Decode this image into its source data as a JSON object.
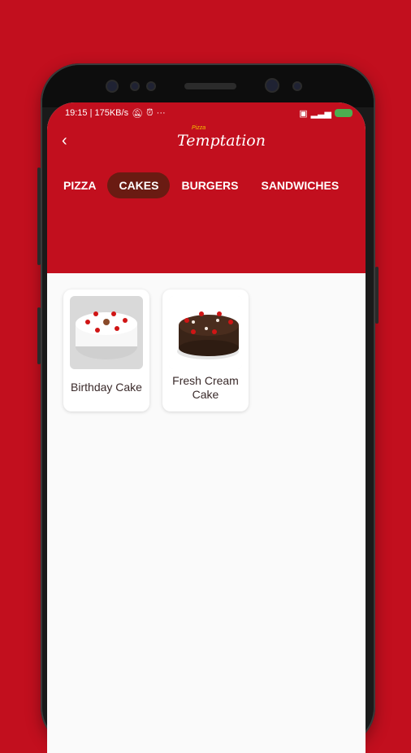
{
  "status": {
    "time_info": "19:15 | 175KB/s",
    "more": "···"
  },
  "header": {
    "back_icon": "chevron-left-icon",
    "logo_small": "Pizza",
    "logo_big": "Temptation"
  },
  "tabs": [
    {
      "label": "PIZZA"
    },
    {
      "label": "CAKES"
    },
    {
      "label": "BURGERS"
    },
    {
      "label": "SANDWICHES"
    }
  ],
  "active_tab": "CAKES",
  "products": [
    {
      "name": "Birthday Cake",
      "image": "white-cake-icon"
    },
    {
      "name": "Fresh Cream Cake",
      "image": "black-forest-cake-icon"
    }
  ],
  "colors": {
    "brand_red": "#c20f1e",
    "active_tab_bg": "#6a1b12",
    "card_text": "#3a2a2a"
  }
}
